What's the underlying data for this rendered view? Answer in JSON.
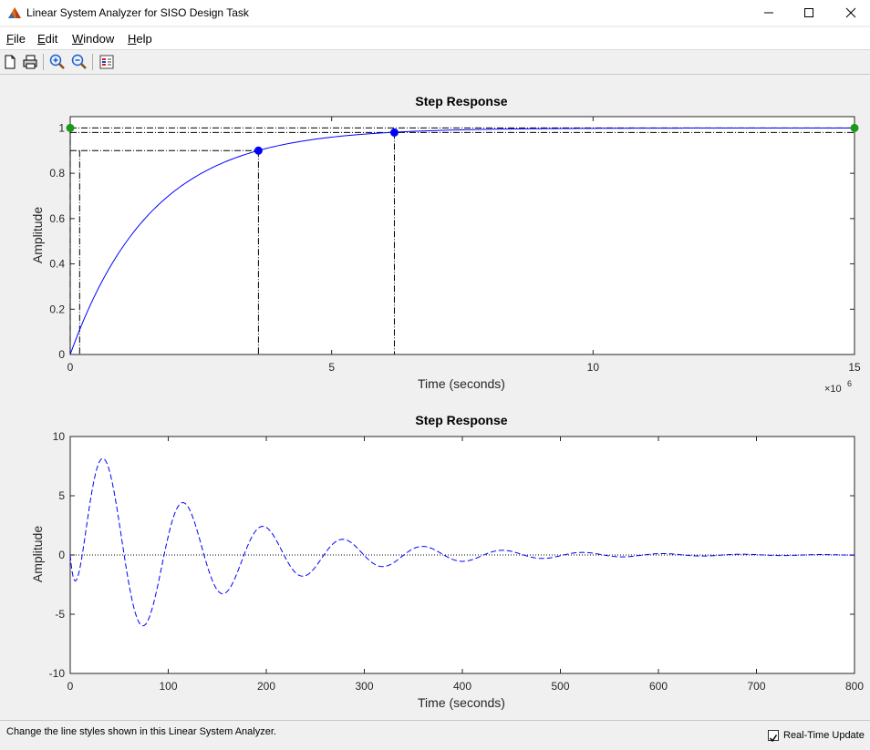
{
  "window": {
    "title": "Linear System Analyzer for SISO Design Task"
  },
  "menu": {
    "items": [
      {
        "label": "File",
        "mnemonic": "F",
        "rest": "ile"
      },
      {
        "label": "Edit",
        "mnemonic": "E",
        "rest": "dit"
      },
      {
        "label": "Window",
        "mnemonic": "W",
        "rest": "indow"
      },
      {
        "label": "Help",
        "mnemonic": "H",
        "rest": "elp"
      }
    ]
  },
  "toolbar": {
    "icons": [
      "new-file-icon",
      "print-icon",
      "zoom-in-icon",
      "zoom-out-icon",
      "legend-icon"
    ]
  },
  "status": {
    "text": "Change the line styles shown in this Linear System Analyzer.",
    "realtime_label": "Real-Time Update",
    "realtime_checked": true
  },
  "colors": {
    "response": "#0000ff",
    "marker_blue": "#0000ff",
    "marker_green": "#1a9a1a",
    "characteristic_lines": "#000000"
  },
  "chart_data": [
    {
      "type": "line",
      "title": "Step Response",
      "xlabel": "Time (seconds)",
      "ylabel": "Amplitude",
      "x_exponent_label": "×10",
      "x_exponent": "6",
      "xlim": [
        0,
        15
      ],
      "ylim": [
        0,
        1.05
      ],
      "xticks": [
        0,
        5,
        10,
        15
      ],
      "xtick_labels": [
        "0",
        "5",
        "10",
        "15"
      ],
      "yticks": [
        0,
        0.2,
        0.4,
        0.6,
        0.8,
        1
      ],
      "ytick_labels": [
        "0",
        "0.2",
        "0.4",
        "0.6",
        "0.8",
        "1"
      ],
      "series": [
        {
          "style": "solid",
          "model": "first_order",
          "final": 1,
          "time_constant": 1.56
        }
      ],
      "markers": [
        {
          "x": 3.6,
          "y": 0.9,
          "color": "blue"
        },
        {
          "x": 6.2,
          "y": 0.98,
          "color": "blue"
        },
        {
          "x": 0,
          "y": 1,
          "color": "green"
        },
        {
          "x": 15,
          "y": 1,
          "color": "green"
        }
      ],
      "characteristic_lines": {
        "rise_start_x": 0.18,
        "rise_end_x": 3.6,
        "rise_level": 0.9,
        "settling_x": 6.2,
        "settling_level": 0.98,
        "steady_state": 1
      }
    },
    {
      "type": "line",
      "title": "Step Response",
      "xlabel": "Time (seconds)",
      "ylabel": "Amplitude",
      "xlim": [
        0,
        800
      ],
      "ylim": [
        -10,
        10
      ],
      "xticks": [
        0,
        100,
        200,
        300,
        400,
        500,
        600,
        700,
        800
      ],
      "xtick_labels": [
        "0",
        "100",
        "200",
        "300",
        "400",
        "500",
        "600",
        "700",
        "800"
      ],
      "yticks": [
        -10,
        -5,
        0,
        5,
        10
      ],
      "ytick_labels": [
        "-10",
        "-5",
        "0",
        "5",
        "10"
      ],
      "series": [
        {
          "style": "dashed",
          "model": "damped_oscillation",
          "amplitude": 10.4,
          "decay": 0.0074,
          "period": 81.5,
          "phase": -1.1
        }
      ],
      "reference_line": {
        "y": 0,
        "style": "dotted"
      }
    }
  ]
}
